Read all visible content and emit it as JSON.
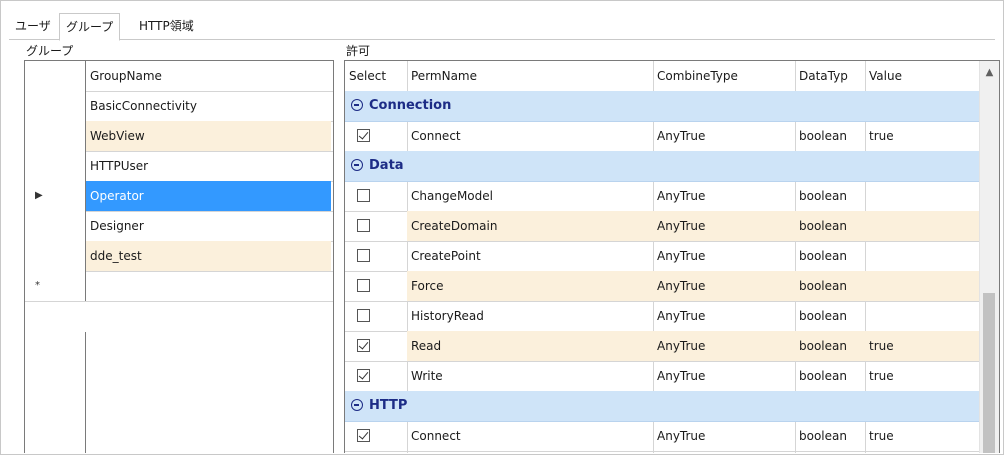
{
  "tabs": [
    {
      "label": "ユーザ"
    },
    {
      "label": "グループ"
    },
    {
      "label": "HTTP領域"
    }
  ],
  "groups_panel": {
    "label": "グループ",
    "header": "GroupName",
    "rows": [
      {
        "name": "BasicConnectivity",
        "indicator": ""
      },
      {
        "name": "WebView",
        "indicator": ""
      },
      {
        "name": "HTTPUser",
        "indicator": ""
      },
      {
        "name": "Operator",
        "indicator": "▶"
      },
      {
        "name": "Designer",
        "indicator": ""
      },
      {
        "name": "dde_test",
        "indicator": ""
      },
      {
        "name": "",
        "indicator": "*"
      }
    ]
  },
  "permissions_panel": {
    "label": "許可",
    "headers": {
      "select": "Select",
      "perm": "PermName",
      "combine": "CombineType",
      "datatype": "DataTyp",
      "value": "Value"
    },
    "groups": [
      {
        "title": "Connection",
        "rows": [
          {
            "checked": true,
            "perm": "Connect",
            "combine": "AnyTrue",
            "datatype": "boolean",
            "value": "true"
          }
        ]
      },
      {
        "title": "Data",
        "rows": [
          {
            "checked": false,
            "perm": "ChangeModel",
            "combine": "AnyTrue",
            "datatype": "boolean",
            "value": ""
          },
          {
            "checked": false,
            "perm": "CreateDomain",
            "combine": "AnyTrue",
            "datatype": "boolean",
            "value": ""
          },
          {
            "checked": false,
            "perm": "CreatePoint",
            "combine": "AnyTrue",
            "datatype": "boolean",
            "value": ""
          },
          {
            "checked": false,
            "perm": "Force",
            "combine": "AnyTrue",
            "datatype": "boolean",
            "value": ""
          },
          {
            "checked": false,
            "perm": "HistoryRead",
            "combine": "AnyTrue",
            "datatype": "boolean",
            "value": ""
          },
          {
            "checked": true,
            "perm": "Read",
            "combine": "AnyTrue",
            "datatype": "boolean",
            "value": "true"
          },
          {
            "checked": true,
            "perm": "Write",
            "combine": "AnyTrue",
            "datatype": "boolean",
            "value": "true"
          }
        ]
      },
      {
        "title": "HTTP",
        "rows": [
          {
            "checked": true,
            "perm": "Connect",
            "combine": "AnyTrue",
            "datatype": "boolean",
            "value": "true"
          }
        ]
      }
    ]
  },
  "colors": {
    "selected_row": "#3399ff",
    "alt_row": "#fbf0dc",
    "group_header": "#cfe4f8",
    "group_title": "#1d2c86"
  },
  "scrollbar": {
    "up_icon": "chevron-up-icon"
  }
}
